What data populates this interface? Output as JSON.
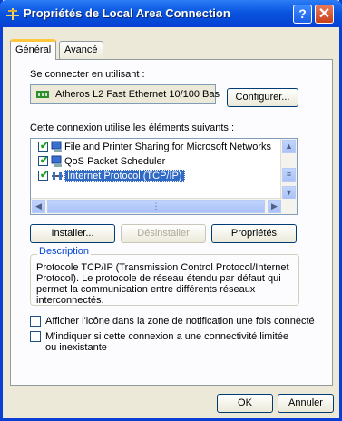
{
  "window": {
    "title": "Propriétés de Local Area Connection",
    "help_button": "?",
    "close_button": "✕"
  },
  "tabs": [
    {
      "label": "Général",
      "active": true
    },
    {
      "label": "Avancé",
      "active": false
    }
  ],
  "connect_using": {
    "label": "Se connecter en utilisant :",
    "adapter": "Atheros L2 Fast Ethernet 10/100 Bas",
    "adapter_icon": "network-adapter-icon",
    "configure_button": "Configurer..."
  },
  "components": {
    "label": "Cette connexion utilise les éléments suivants :",
    "items": [
      {
        "label": "File and Printer Sharing for Microsoft Networks",
        "checked": true,
        "icon": "computer-icon",
        "selected": false
      },
      {
        "label": "QoS Packet Scheduler",
        "checked": true,
        "icon": "computer-icon",
        "selected": false
      },
      {
        "label": "Internet Protocol (TCP/IP)",
        "checked": true,
        "icon": "protocol-icon",
        "selected": true
      }
    ]
  },
  "buttons": {
    "install": "Installer...",
    "uninstall": "Désinstaller",
    "properties": "Propriétés",
    "ok": "OK",
    "cancel": "Annuler"
  },
  "description": {
    "legend": "Description",
    "text": "Protocole TCP/IP (Transmission Control Protocol/Internet Protocol). Le protocole de réseau étendu par défaut qui permet la communication entre différents réseaux interconnectés."
  },
  "options": [
    {
      "label": "Afficher l'icône dans la zone de notification une fois connecté",
      "checked": false
    },
    {
      "label": "M'indiquer si cette connexion a une connectivité limitée ou inexistante",
      "checked": false
    }
  ],
  "colors": {
    "titlebar": "#0a55e0",
    "selection": "#316ac5",
    "legend": "#0046d5"
  }
}
